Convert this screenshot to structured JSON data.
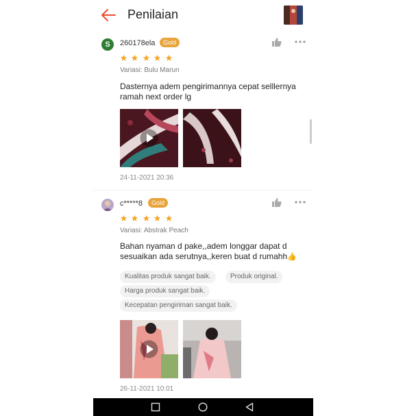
{
  "header": {
    "title": "Penilaian",
    "back_icon": "arrow-left-icon"
  },
  "reviews": [
    {
      "avatar_letter": "S",
      "username": "260178ela",
      "badge": "Gold",
      "rating": 5,
      "variant": "Variasi: Bulu Marun",
      "text": "Dasternya adem pengirimannya cepat selllernya ramah next order lg",
      "tags": [],
      "media_count": 2,
      "date": "24-11-2021 20:36"
    },
    {
      "avatar_letter": "",
      "username": "c*****8",
      "badge": "Gold",
      "rating": 5,
      "variant": "Variasi: Abstrak Peach",
      "text": "Bahan nyaman d pake,,adem longgar dapat d sesuaikan ada serutnya,,keren buat d rumahh",
      "tags": [
        "Kualitas produk sangat baik.",
        "Produk original.",
        "Harga produk sangat baik.",
        "Kecepatan pengiriman sangat baik."
      ],
      "media_count": 2,
      "date": "26-11-2021 10:01"
    }
  ],
  "colors": {
    "accent": "#ee4d2d",
    "star": "#f5a623",
    "badge": "#e8a33b"
  },
  "icons": [
    "arrow-left-icon",
    "thumbs-up-icon",
    "more-icon",
    "play-icon",
    "square-nav-icon",
    "circle-nav-icon",
    "triangle-back-nav-icon"
  ]
}
